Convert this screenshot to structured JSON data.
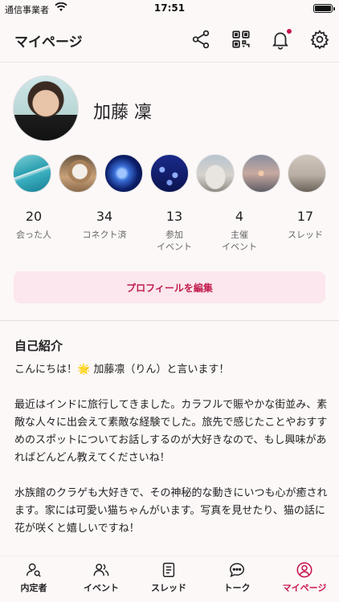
{
  "status_bar": {
    "carrier": "通信事業者",
    "time": "17:51"
  },
  "header": {
    "title": "マイページ"
  },
  "profile": {
    "name": "加藤 凜",
    "photos": [
      {
        "icon": "photo-beach"
      },
      {
        "icon": "photo-cat"
      },
      {
        "icon": "photo-jellyfish"
      },
      {
        "icon": "photo-jellyfish-2"
      },
      {
        "icon": "photo-taj-mahal"
      },
      {
        "icon": "photo-sunset"
      },
      {
        "icon": "photo-river"
      }
    ],
    "stats": [
      {
        "value": "20",
        "label": "会った人"
      },
      {
        "value": "34",
        "label": "コネクト済"
      },
      {
        "value": "13",
        "label": "参加\nイベント"
      },
      {
        "value": "4",
        "label": "主催\nイベント"
      },
      {
        "value": "17",
        "label": "スレッド"
      }
    ],
    "edit_button": "プロフィールを編集"
  },
  "about": {
    "title": "自己紹介",
    "paragraphs": [
      "こんにちは！🌟 加藤凛（りん）と言います！",
      "最近はインドに旅行してきました。カラフルで賑やかな街並み、素敵な人々に出会えて素敵な経験でした。旅先で感じたことやおすすめのスポットについてお話しするのが大好きなので、もし興味があればどんどん教えてくださいね！",
      "水族館のクラゲも大好きで、その神秘的な動きにいつも心が癒されます。家には可愛い猫ちゃんがいます。写真を見せたり、猫の話に花が咲くと嬉しいですね！"
    ]
  },
  "tabs": [
    {
      "label": "内定者",
      "icon": "person-search-icon"
    },
    {
      "label": "イベント",
      "icon": "people-icon"
    },
    {
      "label": "スレッド",
      "icon": "document-icon"
    },
    {
      "label": "トーク",
      "icon": "chat-bubble-icon"
    },
    {
      "label": "マイページ",
      "icon": "profile-icon",
      "active": true
    }
  ],
  "colors": {
    "accent": "#c8164c",
    "edit_bg": "#fbe7ed",
    "background": "#fdf8f8"
  }
}
